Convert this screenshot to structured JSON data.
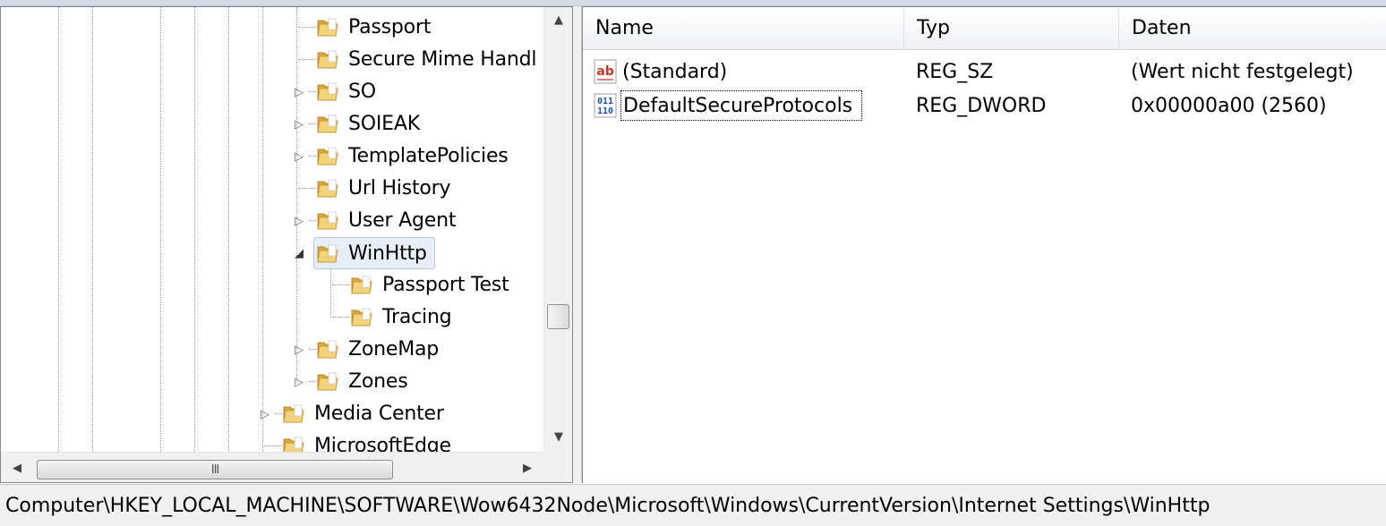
{
  "tree": {
    "nodes": [
      {
        "label": "Passport"
      },
      {
        "label": "Secure Mime Handl"
      },
      {
        "label": "SO"
      },
      {
        "label": "SOIEAK"
      },
      {
        "label": "TemplatePolicies"
      },
      {
        "label": "Url History"
      },
      {
        "label": "User Agent"
      },
      {
        "label": "WinHttp"
      },
      {
        "label": "Passport Test"
      },
      {
        "label": "Tracing"
      },
      {
        "label": "ZoneMap"
      },
      {
        "label": "Zones"
      },
      {
        "label": "Media Center"
      },
      {
        "label": "MicrosoftEdge"
      }
    ],
    "selected": "WinHttp",
    "hscroll_grip": "III"
  },
  "values": {
    "columns": {
      "name": "Name",
      "type": "Typ",
      "data": "Daten"
    },
    "rows": [
      {
        "icon": "string-value-icon",
        "name": "(Standard)",
        "type": "REG_SZ",
        "data": "(Wert nicht festgelegt)"
      },
      {
        "icon": "binary-value-icon",
        "name": "DefaultSecureProtocols",
        "type": "REG_DWORD",
        "data": "0x00000a00 (2560)"
      }
    ]
  },
  "status_bar": {
    "path": "Computer\\HKEY_LOCAL_MACHINE\\SOFTWARE\\Wow6432Node\\Microsoft\\Windows\\CurrentVersion\\Internet Settings\\WinHttp"
  },
  "colors": {
    "folder": "#e8c35a",
    "selection": "#e8eef8",
    "string_icon_red": "#c0392b",
    "binary_icon_blue": "#1f4fb5"
  }
}
